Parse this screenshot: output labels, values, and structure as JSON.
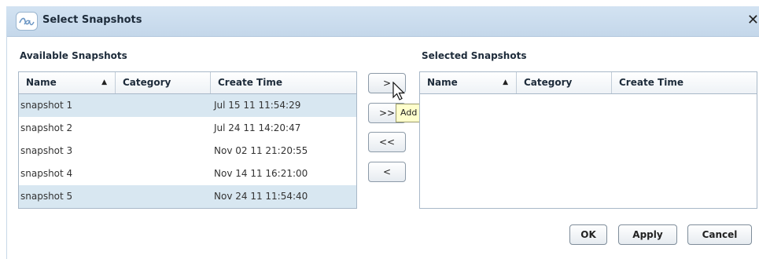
{
  "dialog": {
    "title": "Select Snapshots",
    "close_icon": "close-x-icon"
  },
  "available": {
    "label": "Available Snapshots",
    "columns": [
      "Name",
      "Category",
      "Create Time"
    ],
    "sort_indicator": "▲",
    "rows": [
      {
        "name": "snapshot 1",
        "category": "",
        "time": "Jul 15 11 11:54:29"
      },
      {
        "name": "snapshot 2",
        "category": "",
        "time": "Jul 24 11 14:20:47"
      },
      {
        "name": "snapshot 3",
        "category": "",
        "time": "Nov 02 11 21:20:55"
      },
      {
        "name": "snapshot 4",
        "category": "",
        "time": "Nov 14 11 16:21:00"
      },
      {
        "name": "snapshot 5",
        "category": "",
        "time": "Nov 24 11 11:54:40"
      }
    ]
  },
  "selected": {
    "label": "Selected Snapshots",
    "columns": [
      "Name",
      "Category",
      "Create Time"
    ],
    "sort_indicator": "▲",
    "rows": []
  },
  "transfer": {
    "add": ">",
    "add_all": ">>",
    "remove_all": "<<",
    "remove": "<",
    "tooltip": "Add"
  },
  "footer": {
    "ok": "OK",
    "apply": "Apply",
    "cancel": "Cancel"
  },
  "colors": {
    "titlebar": "#c8dbee",
    "row_alt": "#d8e7f1",
    "tooltip_bg": "#ffffcc"
  }
}
